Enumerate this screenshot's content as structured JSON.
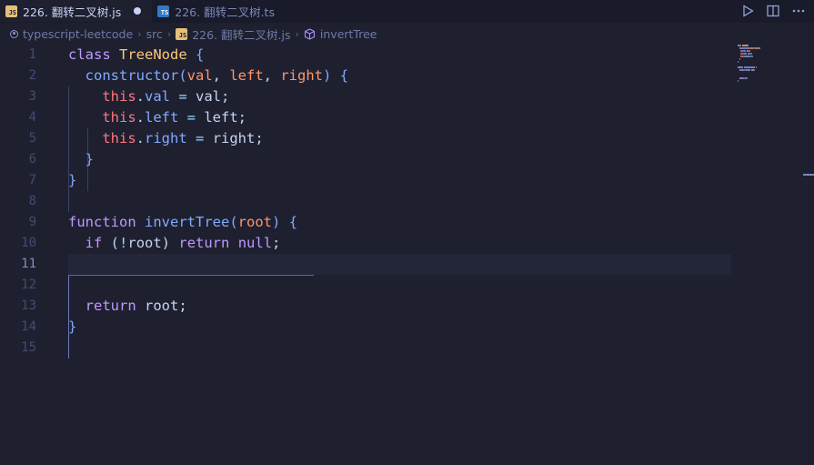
{
  "tabs": [
    {
      "icon": "JS",
      "label": "226. 翻转二叉树.js",
      "active": true,
      "dirty": true
    },
    {
      "icon": "TS",
      "label": "226. 翻转二叉树.ts",
      "active": false
    }
  ],
  "breadcrumb": {
    "folder": "typescript-leetcode",
    "subfolder": "src",
    "file_icon": "JS",
    "file": "226. 翻转二叉树.js",
    "symbol": "invertTree"
  },
  "editor": {
    "current_line": 11,
    "line_numbers": [
      "1",
      "2",
      "3",
      "4",
      "5",
      "6",
      "7",
      "8",
      "9",
      "10",
      "11",
      "12",
      "13",
      "14",
      "15"
    ],
    "lines": [
      [
        {
          "t": "class",
          "c": "kw"
        },
        {
          "t": " "
        },
        {
          "t": "TreeNode",
          "c": "cls"
        },
        {
          "t": " "
        },
        {
          "t": "{",
          "c": "brace"
        }
      ],
      [
        {
          "t": "  "
        },
        {
          "t": "constructor",
          "c": "fn"
        },
        {
          "t": "(",
          "c": "brace"
        },
        {
          "t": "val",
          "c": "param"
        },
        {
          "t": ", "
        },
        {
          "t": "left",
          "c": "param"
        },
        {
          "t": ", "
        },
        {
          "t": "right",
          "c": "param"
        },
        {
          "t": ")",
          "c": "brace"
        },
        {
          "t": " "
        },
        {
          "t": "{",
          "c": "brace"
        }
      ],
      [
        {
          "t": "    "
        },
        {
          "t": "this",
          "c": "this"
        },
        {
          "t": "."
        },
        {
          "t": "val",
          "c": "prop"
        },
        {
          "t": " "
        },
        {
          "t": "=",
          "c": "op"
        },
        {
          "t": " val;"
        }
      ],
      [
        {
          "t": "    "
        },
        {
          "t": "this",
          "c": "this"
        },
        {
          "t": "."
        },
        {
          "t": "left",
          "c": "prop"
        },
        {
          "t": " "
        },
        {
          "t": "=",
          "c": "op"
        },
        {
          "t": " left;"
        }
      ],
      [
        {
          "t": "    "
        },
        {
          "t": "this",
          "c": "this"
        },
        {
          "t": "."
        },
        {
          "t": "right",
          "c": "prop"
        },
        {
          "t": " "
        },
        {
          "t": "=",
          "c": "op"
        },
        {
          "t": " right;"
        }
      ],
      [
        {
          "t": "  "
        },
        {
          "t": "}",
          "c": "brace"
        }
      ],
      [
        {
          "t": "}",
          "c": "brace"
        }
      ],
      [],
      [
        {
          "t": "function",
          "c": "kw"
        },
        {
          "t": " "
        },
        {
          "t": "invertTree",
          "c": "fn"
        },
        {
          "t": "(",
          "c": "brace"
        },
        {
          "t": "root",
          "c": "param"
        },
        {
          "t": ")",
          "c": "brace"
        },
        {
          "t": " "
        },
        {
          "t": "{",
          "c": "brace"
        }
      ],
      [
        {
          "t": "  "
        },
        {
          "t": "if",
          "c": "kw"
        },
        {
          "t": " ("
        },
        {
          "t": "!",
          "c": "op"
        },
        {
          "t": "root) "
        },
        {
          "t": "return",
          "c": "kw"
        },
        {
          "t": " "
        },
        {
          "t": "null",
          "c": "kw"
        },
        {
          "t": ";"
        }
      ],
      [],
      [],
      [
        {
          "t": "  "
        },
        {
          "t": "return",
          "c": "kw"
        },
        {
          "t": " root;"
        }
      ],
      [
        {
          "t": "}",
          "c": "brace"
        }
      ],
      []
    ]
  },
  "actions": [
    "run-icon",
    "split-editor-icon",
    "more-icon"
  ],
  "colors": {
    "background": "#1e2030",
    "tabbar": "#191a2a",
    "keyword": "#c099ff",
    "class": "#ffc777",
    "function": "#82aaff",
    "parameter": "#ff966c",
    "this": "#ff757f"
  }
}
